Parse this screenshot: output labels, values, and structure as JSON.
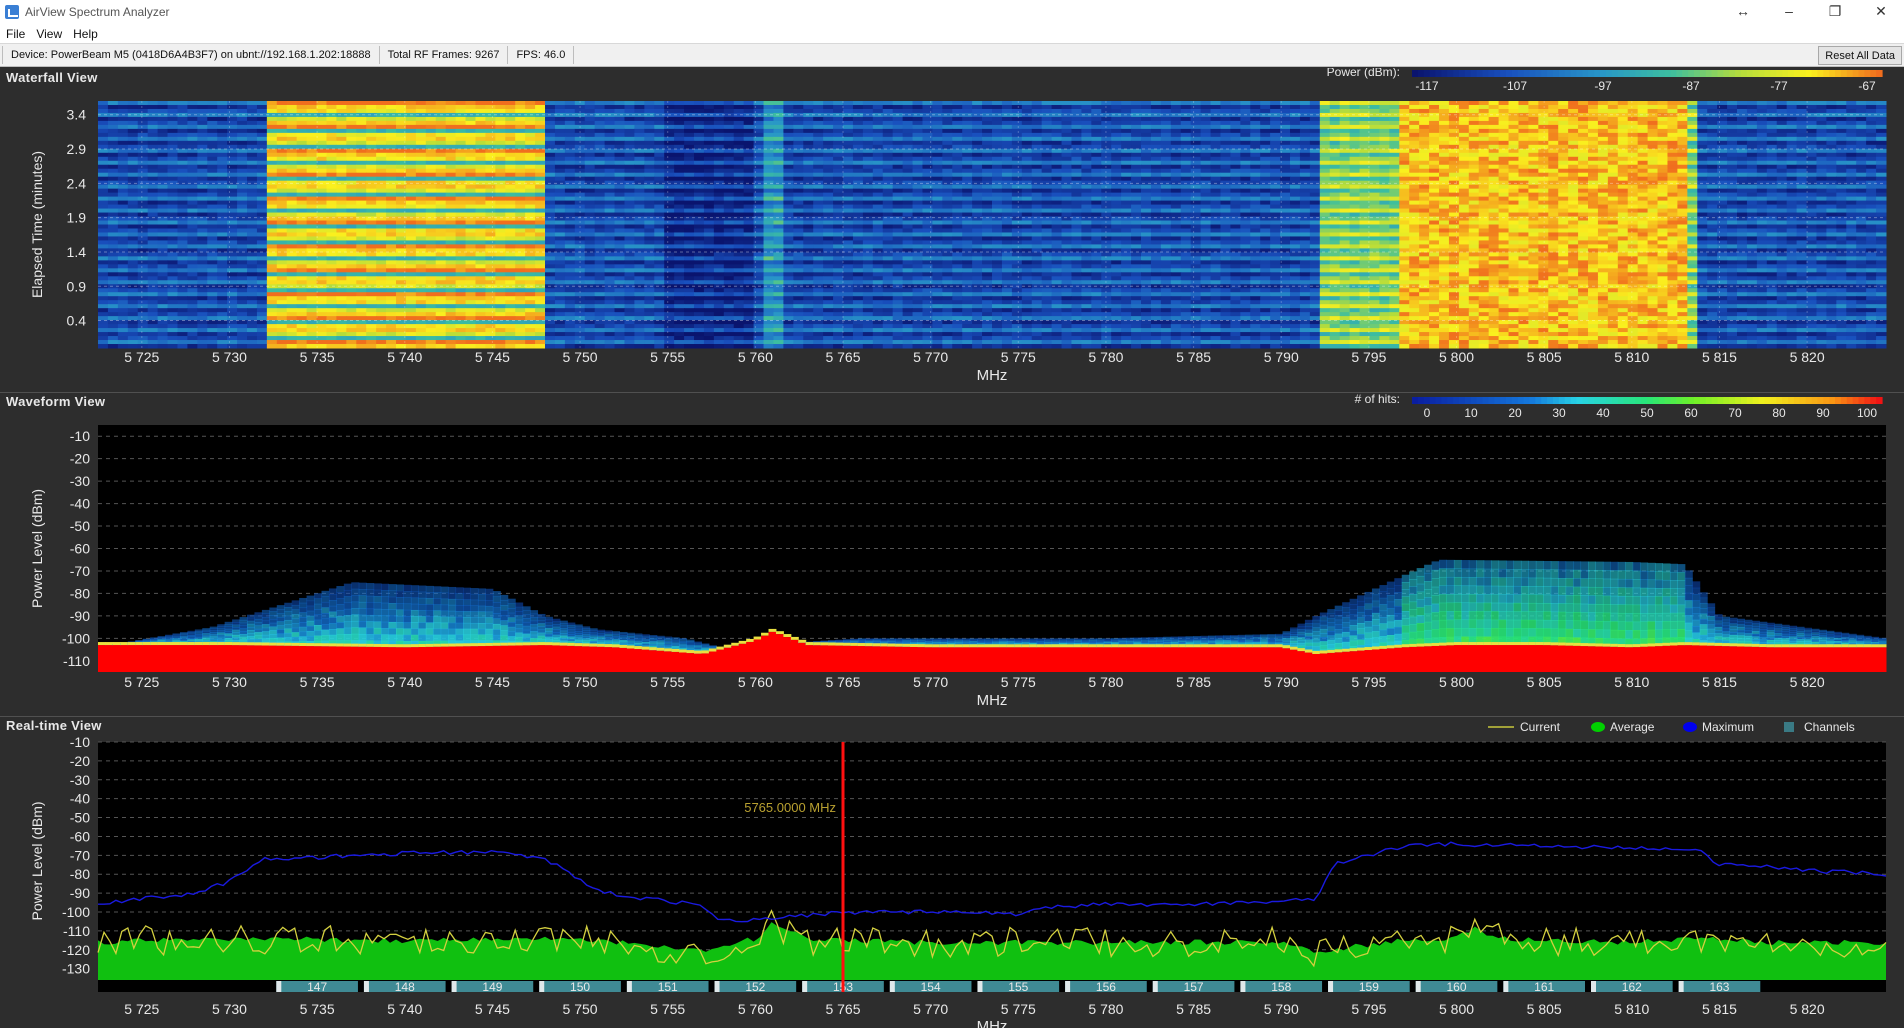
{
  "window": {
    "title": "AirView Spectrum Analyzer"
  },
  "menu": [
    "File",
    "View",
    "Help"
  ],
  "status": {
    "device": "Device: PowerBeam M5 (0418D6A4B3F7) on ubnt://192.168.1.202:18888",
    "frames": "Total RF Frames: 9267",
    "fps": "FPS: 46.0",
    "reset": "Reset All Data"
  },
  "xaxis": {
    "label": "MHz",
    "min": 5722.5,
    "max": 5824.5,
    "ticks": [
      5725,
      5730,
      5735,
      5740,
      5745,
      5750,
      5755,
      5760,
      5765,
      5770,
      5775,
      5780,
      5785,
      5790,
      5795,
      5800,
      5805,
      5810,
      5815,
      5820
    ],
    "tick_labels": [
      "5 725",
      "5 730",
      "5 735",
      "5 740",
      "5 745",
      "5 750",
      "5 755",
      "5 760",
      "5 765",
      "5 770",
      "5 775",
      "5 780",
      "5 785",
      "5 790",
      "5 795",
      "5 800",
      "5 805",
      "5 810",
      "5 815",
      "5 820"
    ]
  },
  "waterfall": {
    "title": "Waterfall View",
    "ylabel": "Elapsed Time (minutes)",
    "yticks": [
      "3.4",
      "2.9",
      "2.4",
      "1.9",
      "1.4",
      "0.9",
      "0.4"
    ],
    "ytick_values": [
      3.4,
      2.9,
      2.4,
      1.9,
      1.4,
      0.9,
      0.4
    ],
    "legend_title": "Power (dBm):",
    "legend_ticks": [
      "-117",
      "-107",
      "-97",
      "-87",
      "-77",
      "-67"
    ]
  },
  "waveform": {
    "title": "Waveform View",
    "ylabel": "Power Level (dBm)",
    "yticks": [
      "-10",
      "-20",
      "-30",
      "-40",
      "-50",
      "-60",
      "-70",
      "-80",
      "-90",
      "-100",
      "-110"
    ],
    "legend_title": "# of hits:",
    "legend_ticks": [
      "0",
      "10",
      "20",
      "30",
      "40",
      "50",
      "60",
      "70",
      "80",
      "90",
      "100"
    ]
  },
  "realtime": {
    "title": "Real-time View",
    "ylabel": "Power Level (dBm)",
    "yticks": [
      "-10",
      "-20",
      "-30",
      "-40",
      "-50",
      "-60",
      "-70",
      "-80",
      "-90",
      "-100",
      "-110",
      "-120",
      "-130"
    ],
    "legend": [
      {
        "label": "Current",
        "color": "#c8c83c"
      },
      {
        "label": "Average",
        "color": "#00d000"
      },
      {
        "label": "Maximum",
        "color": "#0000ee"
      },
      {
        "label": "Channels",
        "color": "#3a7a84"
      }
    ],
    "marker_label": "5765.0000 MHz",
    "marker_freq": 5765,
    "channels": [
      "147",
      "148",
      "149",
      "150",
      "151",
      "152",
      "153",
      "154",
      "155",
      "156",
      "157",
      "158",
      "159",
      "160",
      "161",
      "162",
      "163"
    ]
  },
  "chart_data": [
    {
      "type": "heatmap",
      "title": "Waterfall View",
      "xlabel": "MHz",
      "ylabel": "Elapsed Time (minutes)",
      "xlim": [
        5722.5,
        5824.5
      ],
      "ylim": [
        0,
        3.6
      ],
      "signals": [
        {
          "x_start": 5732,
          "x_end": 5748,
          "power_dbm": -75
        },
        {
          "x_start": 5792,
          "x_end": 5814,
          "power_dbm": -87
        },
        {
          "x_start": 5797,
          "x_end": 5813,
          "power_dbm": -72
        }
      ]
    },
    {
      "type": "area",
      "title": "Waveform View",
      "xlabel": "MHz",
      "ylabel": "Power Level (dBm)",
      "xlim": [
        5722.5,
        5824.5
      ],
      "ylim": [
        -115,
        -5
      ],
      "floor_x": [
        5722.5,
        5730,
        5740,
        5748,
        5752,
        5757,
        5760,
        5761,
        5763,
        5770,
        5780,
        5790,
        5792,
        5797,
        5800,
        5805,
        5810,
        5813,
        5818,
        5824.5
      ],
      "floor_y": [
        -103,
        -103,
        -104,
        -103,
        -104,
        -107,
        -101,
        -97,
        -103,
        -104,
        -104,
        -104,
        -107,
        -104,
        -103,
        -103,
        -104,
        -103,
        -104,
        -104
      ],
      "spread_x": [
        5722.5,
        5729,
        5731,
        5737,
        5745,
        5748,
        5751,
        5756,
        5758,
        5766,
        5780,
        5790,
        5792,
        5797,
        5799,
        5810,
        5813,
        5815,
        5824.5
      ],
      "spread_y": [
        -104,
        -95,
        -90,
        -75,
        -78,
        -90,
        -96,
        -100,
        -104,
        -100,
        -100,
        -98,
        -90,
        -72,
        -65,
        -66,
        -67,
        -90,
        -100
      ]
    },
    {
      "type": "line",
      "title": "Real-time View",
      "xlabel": "MHz",
      "ylabel": "Power Level (dBm)",
      "xlim": [
        5722.5,
        5824.5
      ],
      "ylim": [
        -136,
        -10
      ],
      "series": [
        {
          "name": "Maximum",
          "x": [
            5722.5,
            5725,
            5728,
            5730,
            5732,
            5735,
            5740,
            5745,
            5748,
            5751,
            5753,
            5755,
            5757,
            5758,
            5760,
            5765,
            5770,
            5775,
            5776,
            5780,
            5785,
            5790,
            5792,
            5793,
            5795,
            5797,
            5800,
            5805,
            5810,
            5814,
            5815,
            5818,
            5820,
            5824.5
          ],
          "y": [
            -96,
            -93,
            -90,
            -84,
            -72,
            -71,
            -69,
            -68,
            -72,
            -88,
            -93,
            -94,
            -97,
            -105,
            -104,
            -100,
            -100,
            -101,
            -98,
            -96,
            -96,
            -94,
            -93,
            -75,
            -70,
            -65,
            -64,
            -65,
            -66,
            -68,
            -75,
            -76,
            -78,
            -80
          ]
        },
        {
          "name": "Average",
          "x": [
            5722.5,
            5730,
            5740,
            5748,
            5752,
            5757,
            5760,
            5761,
            5763,
            5770,
            5780,
            5790,
            5792,
            5797,
            5800,
            5801,
            5802,
            5805,
            5810,
            5813,
            5818,
            5824.5
          ],
          "y": [
            -116,
            -114,
            -115,
            -114,
            -116,
            -121,
            -114,
            -106,
            -115,
            -116,
            -116,
            -116,
            -121,
            -115,
            -114,
            -108,
            -114,
            -115,
            -116,
            -114,
            -116,
            -116
          ]
        }
      ],
      "marker": {
        "x": 5765,
        "label": "5765.0000 MHz"
      }
    }
  ]
}
